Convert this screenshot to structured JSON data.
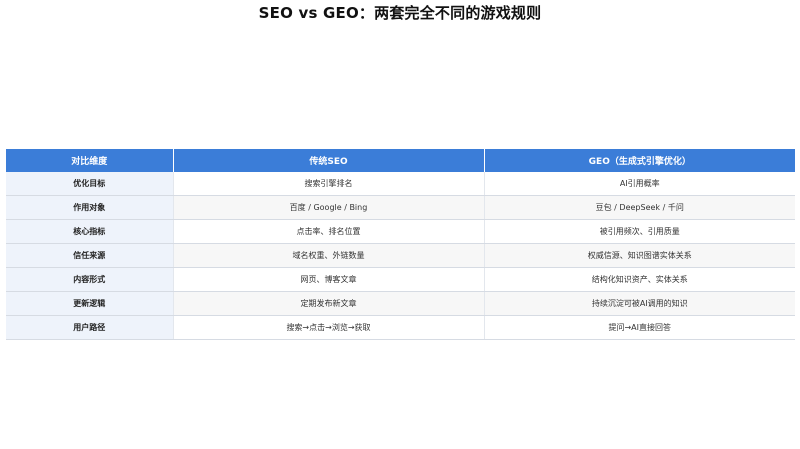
{
  "title": "SEO vs GEO：两套完全不同的游戏规则",
  "table": {
    "headers": [
      "对比维度",
      "传统SEO",
      "GEO（生成式引擎优化）"
    ],
    "rows": [
      [
        "优化目标",
        "搜索引擎排名",
        "AI引用概率"
      ],
      [
        "作用对象",
        "百度 / Google / Bing",
        "豆包 / DeepSeek / 千问"
      ],
      [
        "核心指标",
        "点击率、排名位置",
        "被引用频次、引用质量"
      ],
      [
        "信任来源",
        "域名权重、外链数量",
        "权威信源、知识图谱实体关系"
      ],
      [
        "内容形式",
        "网页、博客文章",
        "结构化知识资产、实体关系"
      ],
      [
        "更新逻辑",
        "定期发布新文章",
        "持续沉淀可被AI调用的知识"
      ],
      [
        "用户路径",
        "搜索→点击→浏览→获取",
        "提问→AI直接回答"
      ]
    ]
  }
}
